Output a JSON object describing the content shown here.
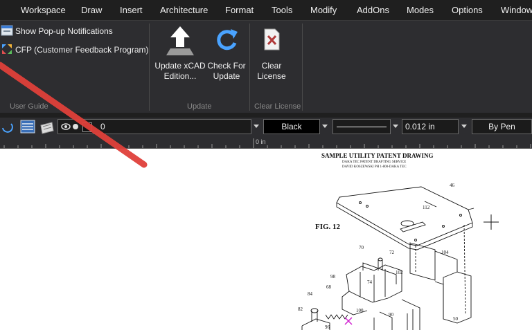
{
  "menubar": {
    "items": [
      "Workspace",
      "Draw",
      "Insert",
      "Architecture",
      "Format",
      "Tools",
      "Modify",
      "AddOns",
      "Modes",
      "Options",
      "Window"
    ]
  },
  "ribbon": {
    "user_guide": {
      "popup_label": "Show Pop-up Notifications",
      "cfp_label": "CFP (Customer Feedback Program)",
      "group_label": "User Guide"
    },
    "update": {
      "update_label_1": "Update xCAD",
      "update_label_2": "Edition...",
      "check_label_1": "Check For",
      "check_label_2": "Update",
      "group_label": "Update"
    },
    "clear_license": {
      "label_1": "Clear",
      "label_2": "License",
      "group_label": "Clear License"
    }
  },
  "properties": {
    "layer_value": "0",
    "color_value": "Black",
    "lineweight_value": "0.012 in",
    "pen_value": "By Pen"
  },
  "ruler": {
    "origin_label": "0 in"
  },
  "drawing": {
    "title": "SAMPLE UTILITY PATENT DRAWING",
    "subtitle_1": "DAKA TEC PATENT DRAFTING SERVICE",
    "subtitle_2": "DAVID KOSZEWSKI PH  1-800-DAKA TEC",
    "fig_label": "FIG. 12",
    "ref_numbers": [
      "46",
      "112",
      "104",
      "70",
      "72",
      "98",
      "102",
      "68",
      "74",
      "84",
      "82",
      "100",
      "90",
      "50",
      "96"
    ]
  },
  "colors": {
    "accent_arrow": "#e0403a",
    "menu_bg": "#1f1f1f",
    "ribbon_bg": "#2d2d30",
    "update_icon": "#4aa3ff"
  }
}
